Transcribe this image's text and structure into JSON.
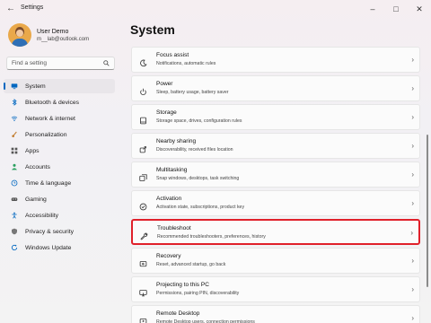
{
  "window": {
    "title": "Settings"
  },
  "user": {
    "name": "User Demo",
    "email": "m__lab@outlook.com"
  },
  "search": {
    "placeholder": "Find a setting"
  },
  "nav": [
    {
      "label": "System",
      "icon": "monitor-icon",
      "color": "#0067c0"
    },
    {
      "label": "Bluetooth & devices",
      "icon": "bluetooth-icon",
      "color": "#0067c0"
    },
    {
      "label": "Network & internet",
      "icon": "wifi-icon",
      "color": "#0067c0"
    },
    {
      "label": "Personalization",
      "icon": "paintbrush-icon",
      "color": "#c27c2f"
    },
    {
      "label": "Apps",
      "icon": "apps-icon",
      "color": "#555555"
    },
    {
      "label": "Accounts",
      "icon": "person-icon",
      "color": "#2aa05f"
    },
    {
      "label": "Time & language",
      "icon": "globe-clock-icon",
      "color": "#0067c0"
    },
    {
      "label": "Gaming",
      "icon": "gamepad-icon",
      "color": "#555555"
    },
    {
      "label": "Accessibility",
      "icon": "accessibility-icon",
      "color": "#0067c0"
    },
    {
      "label": "Privacy & security",
      "icon": "shield-icon",
      "color": "#777777"
    },
    {
      "label": "Windows Update",
      "icon": "update-icon",
      "color": "#0067c0"
    }
  ],
  "main": {
    "title": "System",
    "cards": [
      {
        "title": "Focus assist",
        "subtitle": "Notifications, automatic rules",
        "icon": "moon-icon"
      },
      {
        "title": "Power",
        "subtitle": "Sleep, battery usage, battery saver",
        "icon": "power-icon"
      },
      {
        "title": "Storage",
        "subtitle": "Storage space, drives, configuration rules",
        "icon": "storage-icon"
      },
      {
        "title": "Nearby sharing",
        "subtitle": "Discoverability, received files location",
        "icon": "share-icon"
      },
      {
        "title": "Multitasking",
        "subtitle": "Snap windows, desktops, task switching",
        "icon": "multitask-icon"
      },
      {
        "title": "Activation",
        "subtitle": "Activation state, subscriptions, product key",
        "icon": "check-circle-icon"
      },
      {
        "title": "Troubleshoot",
        "subtitle": "Recommended troubleshooters, preferences, history",
        "icon": "wrench-icon"
      },
      {
        "title": "Recovery",
        "subtitle": "Reset, advanced startup, go back",
        "icon": "recovery-icon"
      },
      {
        "title": "Projecting to this PC",
        "subtitle": "Permissions, pairing PIN, discoverability",
        "icon": "projector-icon"
      },
      {
        "title": "Remote Desktop",
        "subtitle": "Remote Desktop users, connection permissions",
        "icon": "remote-desktop-icon"
      }
    ]
  },
  "accent": "#0067c0",
  "highlight_color": "#e0202a"
}
